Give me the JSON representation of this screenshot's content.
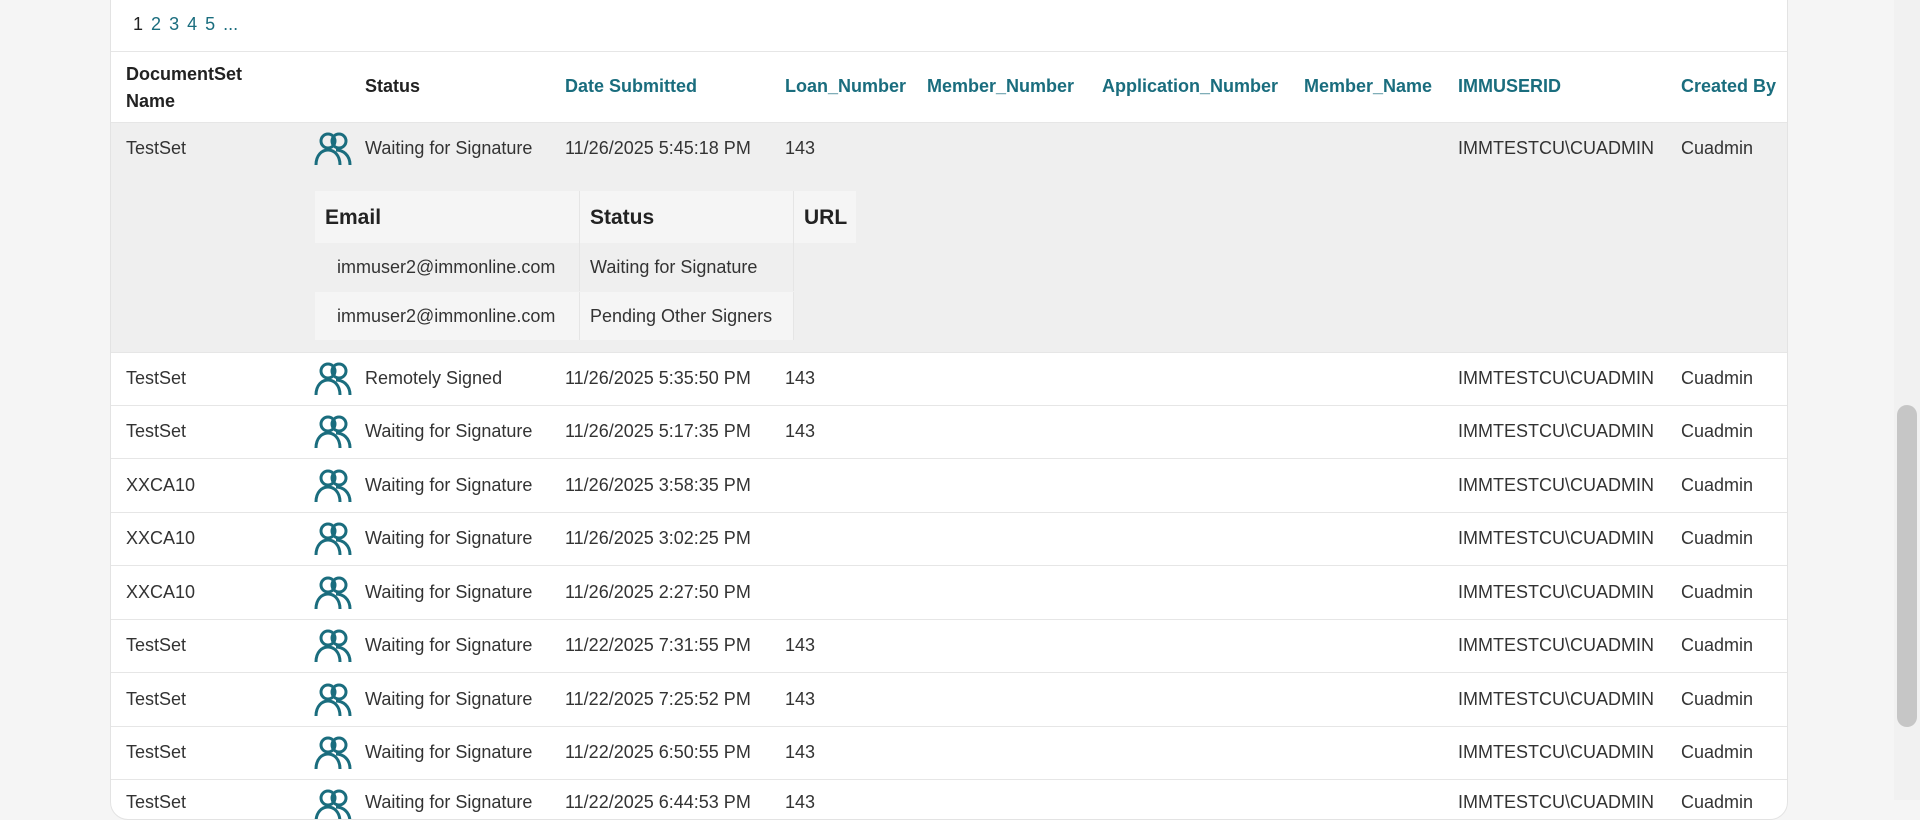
{
  "pagination": {
    "pages": [
      "1",
      "2",
      "3",
      "4",
      "5",
      "..."
    ]
  },
  "columns": {
    "name": "DocumentSet Name",
    "status": "Status",
    "date": "Date Submitted",
    "loan": "Loan_Number",
    "member": "Member_Number",
    "application": "Application_Number",
    "member_name": "Member_Name",
    "userid": "IMMUSERID",
    "created_by": "Created By"
  },
  "rows": [
    {
      "name": "TestSet",
      "status": "Waiting for Signature",
      "date": "11/26/2025 5:45:18 PM",
      "loan": "143",
      "userid": "IMMTESTCU\\CUADMIN",
      "created_by": "Cuadmin"
    },
    {
      "name": "TestSet",
      "status": "Remotely Signed",
      "date": "11/26/2025 5:35:50 PM",
      "loan": "143",
      "userid": "IMMTESTCU\\CUADMIN",
      "created_by": "Cuadmin"
    },
    {
      "name": "TestSet",
      "status": "Waiting for Signature",
      "date": "11/26/2025 5:17:35 PM",
      "loan": "143",
      "userid": "IMMTESTCU\\CUADMIN",
      "created_by": "Cuadmin"
    },
    {
      "name": "XXCA10",
      "status": "Waiting for Signature",
      "date": "11/26/2025 3:58:35 PM",
      "loan": "",
      "userid": "IMMTESTCU\\CUADMIN",
      "created_by": "Cuadmin"
    },
    {
      "name": "XXCA10",
      "status": "Waiting for Signature",
      "date": "11/26/2025 3:02:25 PM",
      "loan": "",
      "userid": "IMMTESTCU\\CUADMIN",
      "created_by": "Cuadmin"
    },
    {
      "name": "XXCA10",
      "status": "Waiting for Signature",
      "date": "11/26/2025 2:27:50 PM",
      "loan": "",
      "userid": "IMMTESTCU\\CUADMIN",
      "created_by": "Cuadmin"
    },
    {
      "name": "TestSet",
      "status": "Waiting for Signature",
      "date": "11/22/2025 7:31:55 PM",
      "loan": "143",
      "userid": "IMMTESTCU\\CUADMIN",
      "created_by": "Cuadmin"
    },
    {
      "name": "TestSet",
      "status": "Waiting for Signature",
      "date": "11/22/2025 7:25:52 PM",
      "loan": "143",
      "userid": "IMMTESTCU\\CUADMIN",
      "created_by": "Cuadmin"
    },
    {
      "name": "TestSet",
      "status": "Waiting for Signature",
      "date": "11/22/2025 6:50:55 PM",
      "loan": "143",
      "userid": "IMMTESTCU\\CUADMIN",
      "created_by": "Cuadmin"
    },
    {
      "name": "TestSet",
      "status": "Waiting for Signature",
      "date": "11/22/2025 6:44:53 PM",
      "loan": "143",
      "userid": "IMMTESTCU\\CUADMIN",
      "created_by": "Cuadmin"
    }
  ],
  "signers": {
    "headers": {
      "email": "Email",
      "status": "Status",
      "url": "URL"
    },
    "items": [
      {
        "email": "immuser2@immonline.com",
        "status": "Waiting for Signature"
      },
      {
        "email": "immuser2@immonline.com",
        "status": "Pending Other Signers"
      }
    ]
  },
  "colors": {
    "accent": "#1a6d7e",
    "expanded_bg": "#efefef"
  },
  "icons": {
    "signers": "users-icon"
  }
}
